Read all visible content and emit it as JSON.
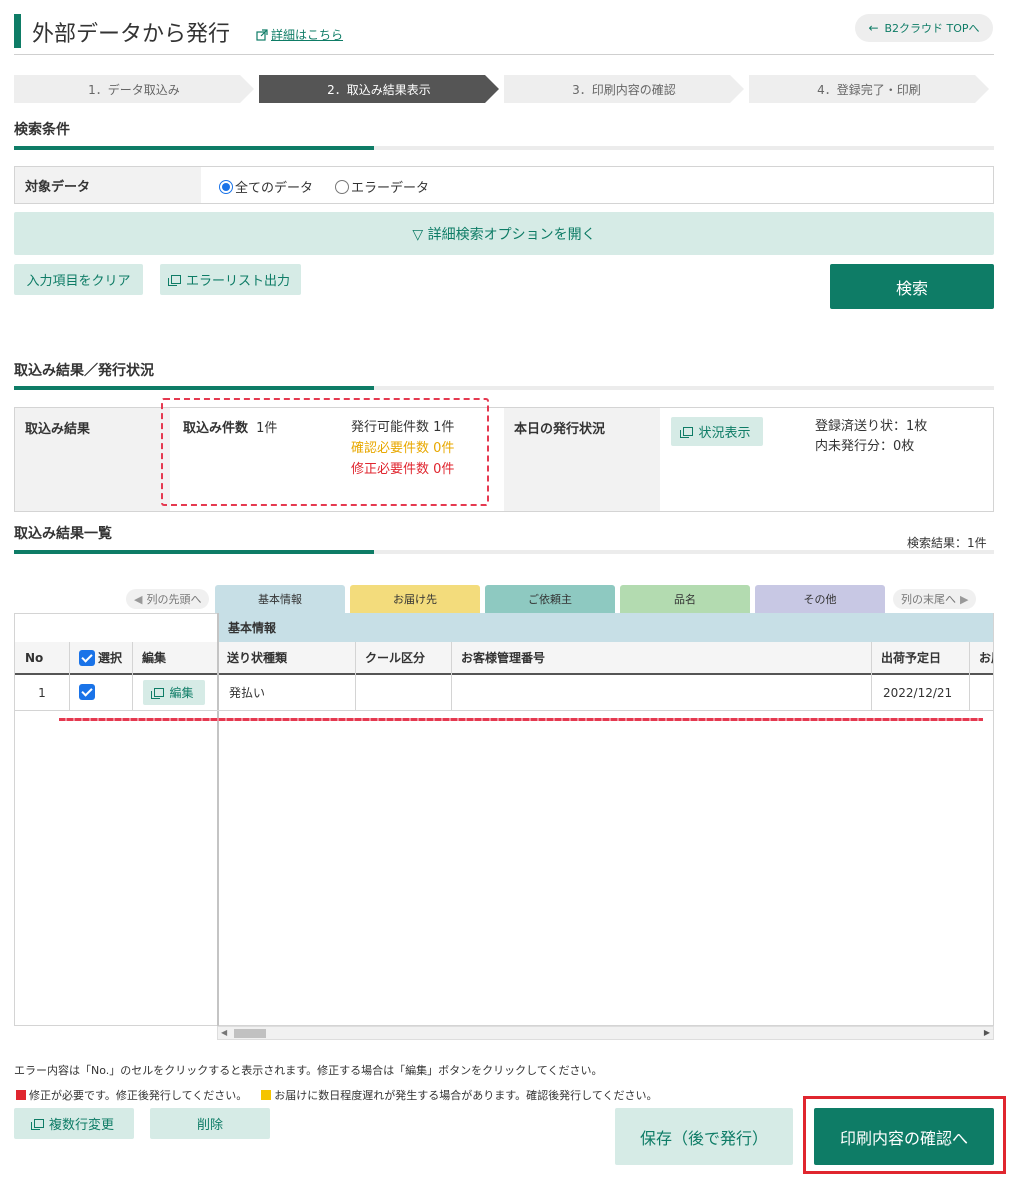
{
  "header": {
    "title": "外部データから発行",
    "detail_link": "詳細はこちら",
    "top_button": "B2クラウド TOPへ"
  },
  "steps": [
    {
      "label": "1．データ取込み",
      "active": false
    },
    {
      "label": "2．取込み結果表示",
      "active": true
    },
    {
      "label": "3．印刷内容の確認",
      "active": false
    },
    {
      "label": "4．登録完了・印刷",
      "active": false
    }
  ],
  "search": {
    "section_title": "検索条件",
    "target_label": "対象データ",
    "radio_all": "全てのデータ",
    "radio_error": "エラーデータ",
    "selected": "all",
    "open_options": "▽ 詳細検索オプションを開く",
    "clear_button": "入力項目をクリア",
    "error_list_button": "エラーリスト出力",
    "search_button": "検索"
  },
  "results": {
    "section_title": "取込み結果／発行状況",
    "result_label": "取込み結果",
    "import_count_label": "取込み件数",
    "import_count_value": "1件",
    "issuable": "発行可能件数 1件",
    "confirm_needed": "確認必要件数 0件",
    "fix_needed": "修正必要件数 0件",
    "today_label": "本日の発行状況",
    "status_button": "状況表示",
    "registered": "登録済送り状：1枚",
    "unissued": "内未発行分：0枚"
  },
  "list": {
    "section_title": "取込み結果一覧",
    "search_result_count": "検索結果：1件",
    "nav_first": "列の先頭へ",
    "nav_last": "列の末尾へ",
    "tabs": [
      {
        "label": "基本情報",
        "color": "#c7dfe6"
      },
      {
        "label": "お届け先",
        "color": "#f3dc7c"
      },
      {
        "label": "ご依頼主",
        "color": "#8ec9c1"
      },
      {
        "label": "品名",
        "color": "#b3dbb0"
      },
      {
        "label": "その他",
        "color": "#c8c8e4"
      }
    ],
    "group_header": "基本情報",
    "columns": {
      "no": "No",
      "select": "選択",
      "edit": "編集",
      "slip_type": "送り状種類",
      "cool": "クール区分",
      "customer_no": "お客様管理番号",
      "ship_date": "出荷予定日",
      "extra": "お届"
    },
    "rows": [
      {
        "no": "1",
        "checked": true,
        "edit_button": "編集",
        "slip_type": "発払い",
        "cool": "",
        "customer_no": "",
        "ship_date": "2022/12/21"
      }
    ]
  },
  "footer": {
    "note1": "エラー内容は「No.」のセルをクリックすると表示されます。修正する場合は「編集」ボタンをクリックしてください。",
    "note2_red": "修正が必要です。修正後発行してください。",
    "note2_yellow": "お届けに数日程度遅れが発生する場合があります。確認後発行してください。",
    "multi_edit": "複数行変更",
    "delete": "削除",
    "save_later": "保存（後で発行）",
    "confirm_print": "印刷内容の確認へ"
  },
  "colors": {
    "accent": "#0e7c66",
    "warn_yellow": "#e8a800",
    "error_red": "#e0262f"
  }
}
